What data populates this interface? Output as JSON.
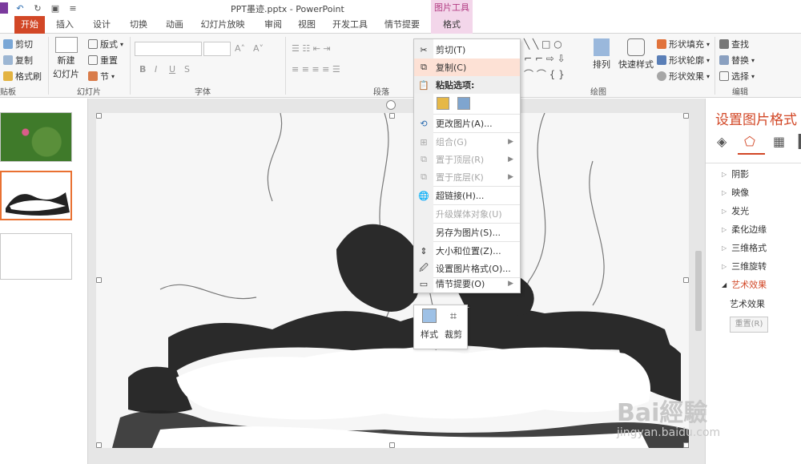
{
  "document": {
    "title": "PPT墨迹.pptx - PowerPoint"
  },
  "contextual_tab_group": {
    "label": "图片工具"
  },
  "tabs": [
    {
      "label": "开始",
      "active": true
    },
    {
      "label": "插入"
    },
    {
      "label": "设计"
    },
    {
      "label": "切换"
    },
    {
      "label": "动画"
    },
    {
      "label": "幻灯片放映"
    },
    {
      "label": "审阅"
    },
    {
      "label": "视图"
    },
    {
      "label": "开发工具"
    },
    {
      "label": "情节提要"
    },
    {
      "label": "格式"
    }
  ],
  "ribbon": {
    "clipboard": {
      "cut": "剪切",
      "copy": "复制",
      "format_painter": "格式刷",
      "group_label": "贴板"
    },
    "slides": {
      "new_slide_1": "新建",
      "new_slide_2": "幻灯片",
      "layout": "版式",
      "reset": "重置",
      "section": "节",
      "group_label": "幻灯片"
    },
    "font": {
      "bold": "B",
      "italic": "I",
      "underline": "U",
      "strike": "S",
      "group_label": "字体"
    },
    "paragraph": {
      "group_label": "段落"
    },
    "drawing": {
      "arrange": "排列",
      "quick_styles": "快速样式",
      "shape_fill": "形状填充",
      "shape_outline": "形状轮廓",
      "shape_effects": "形状效果",
      "group_label": "绘图"
    },
    "editing": {
      "find": "查找",
      "replace": "替换",
      "select": "选择",
      "group_label": "编辑"
    }
  },
  "context_menu": {
    "items": [
      {
        "label": "剪切(T)",
        "icon": "scissors-icon"
      },
      {
        "label": "复制(C)",
        "icon": "copy-icon",
        "highlighted": true
      },
      {
        "label": "粘贴选项:",
        "icon": "paste-icon",
        "header": true
      },
      {
        "label": "更改图片(A)...",
        "icon": "change-picture-icon"
      },
      {
        "label": "组合(G)",
        "icon": "group-icon",
        "disabled": true,
        "submenu": true
      },
      {
        "label": "置于顶层(R)",
        "icon": "bring-front-icon",
        "disabled": true,
        "submenu": true
      },
      {
        "label": "置于底层(K)",
        "icon": "send-back-icon",
        "disabled": true,
        "submenu": true
      },
      {
        "label": "超链接(H)...",
        "icon": "hyperlink-icon"
      },
      {
        "label": "升级媒体对象(U)",
        "disabled": true
      },
      {
        "label": "另存为图片(S)..."
      },
      {
        "label": "大小和位置(Z)...",
        "icon": "size-position-icon"
      },
      {
        "label": "设置图片格式(O)...",
        "icon": "format-picture-icon"
      },
      {
        "label": "情节提要(O)",
        "icon": "storyboard-icon",
        "submenu": true
      }
    ]
  },
  "mini_toolbar": {
    "style": "样式",
    "crop": "裁剪"
  },
  "format_panel": {
    "title": "设置图片格式",
    "items": [
      {
        "label": "阴影",
        "expanded": false
      },
      {
        "label": "映像",
        "expanded": false
      },
      {
        "label": "发光",
        "expanded": false
      },
      {
        "label": "柔化边缘",
        "expanded": false
      },
      {
        "label": "三维格式",
        "expanded": false
      },
      {
        "label": "三维旋转",
        "expanded": false
      },
      {
        "label": "艺术效果",
        "expanded": true
      }
    ],
    "sub_label": "艺术效果",
    "reset_button": "重置(R)"
  },
  "watermark": {
    "brand": "Bai經驗",
    "url": "jingyan.baidu.com"
  },
  "colors": {
    "accent": "#d24726",
    "context_tab": "#f3d6ea",
    "selected_thumb": "#e97132"
  }
}
